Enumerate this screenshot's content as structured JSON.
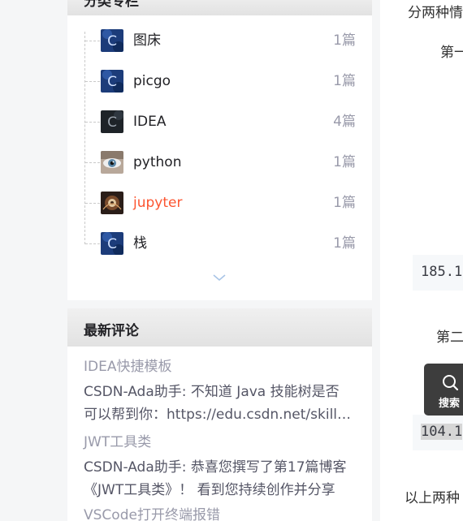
{
  "categories": {
    "header_title": "分类专栏",
    "items": [
      {
        "name": "图床",
        "count": "1篇",
        "thumb": "c-logo-icon"
      },
      {
        "name": "picgo",
        "count": "1篇",
        "thumb": "c-logo-icon"
      },
      {
        "name": "IDEA",
        "count": "4篇",
        "thumb": "c-logo-dark-icon"
      },
      {
        "name": "python",
        "count": "1篇",
        "thumb": "eye-photo-icon"
      },
      {
        "name": "jupyter",
        "count": "1篇",
        "thumb": "fractal-photo-icon",
        "active": true
      },
      {
        "name": "栈",
        "count": "1篇",
        "thumb": "c-logo-icon"
      }
    ],
    "expand_icon": "chevron-down-icon",
    "accent_color": "#fc5531"
  },
  "comments": {
    "header_title": "最新评论",
    "items": [
      {
        "title": "IDEA快捷模板",
        "line1": "CSDN-Ada助手: 不知道 Java 技能树是否",
        "line2": "可以帮到你：https://edu.csdn.net/skill/java"
      },
      {
        "title": "JWT工具类",
        "line1": "CSDN-Ada助手: 恭喜您撰写了第17篇博客",
        "line2": "《JWT工具类》！ 看到您持续创作并分享"
      },
      {
        "title": "VSCode打开终端报错",
        "line1": "",
        "line2": ""
      }
    ]
  },
  "main": {
    "line_top": "分两种情",
    "first_label": "第一",
    "code1": "185.1",
    "second_label": "第二",
    "code2": "104.1",
    "bottom_text": "以上两种"
  },
  "search": {
    "label": "搜索",
    "icon": "search-icon"
  }
}
